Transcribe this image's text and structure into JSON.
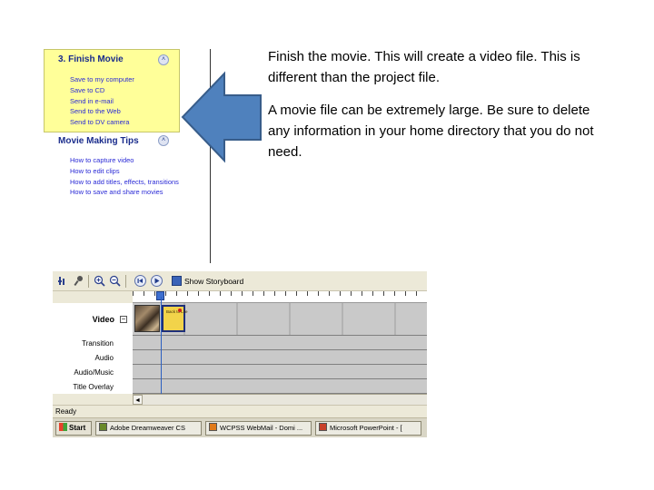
{
  "task_pane": {
    "finish_movie": {
      "title": "3. Finish Movie",
      "collapse_glyph": "˄",
      "items": [
        "Save to my computer",
        "Save to CD",
        "Send in e-mail",
        "Send to the Web",
        "Send to DV camera"
      ]
    },
    "tips": {
      "title": "Movie Making Tips",
      "collapse_glyph": "˄",
      "items": [
        "How to capture video",
        "How to edit clips",
        "How to add titles, effects, transitions",
        "How to save and share movies"
      ]
    }
  },
  "arrow": {
    "direction": "left",
    "fill": "#4f81bd",
    "stroke": "#385d8a",
    "icon": "left-arrow-icon"
  },
  "slide_text": {
    "paragraph1": "Finish the movie. This will create a video file. This is different than the project file.",
    "paragraph2": "A movie file can be extremely large. Be sure to delete any information in your home directory that you do not need."
  },
  "timeline": {
    "toolbar": {
      "show_storyboard_label": "Show Storyboard",
      "icons": [
        "set-audio-levels-icon",
        "narrate-timeline-icon",
        "zoom-in-icon",
        "zoom-out-icon",
        "rewind-icon",
        "play-icon",
        "storyboard-icon"
      ]
    },
    "tracks": {
      "video": "Video",
      "expand_glyph": "−",
      "transition": "Transition",
      "audio": "Audio",
      "audio_music": "Audio/Music",
      "title_overlay": "Title Overlay"
    },
    "clips": [
      {
        "type": "photo",
        "icon": "photo-clip-thumbnail"
      },
      {
        "type": "title",
        "text": "Back to Life"
      }
    ],
    "scroll_left_glyph": "◄",
    "status": "Ready"
  },
  "taskbar": {
    "start_label": "Start",
    "items": [
      {
        "label": "Adobe Dreamweaver CS",
        "icon_color": "#6a8a2a"
      },
      {
        "label": "WCPSS WebMail - Domi ...",
        "icon_color": "#e07a1a"
      },
      {
        "label": "Microsoft PowerPoint - [",
        "icon_color": "#c8402a"
      }
    ]
  },
  "colors": {
    "task_pane_highlight": "#ffff99",
    "link_blue": "#2b2bd6",
    "heading_blue": "#1a2c8c",
    "playhead": "#2d5fc0"
  }
}
